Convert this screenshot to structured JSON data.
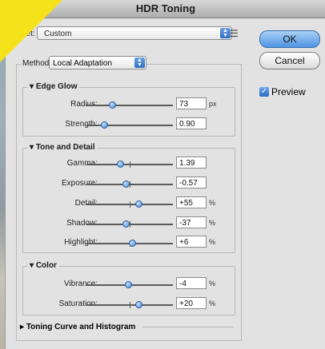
{
  "window": {
    "title": "HDR Toning"
  },
  "preset": {
    "label": "eset:",
    "value": "Custom"
  },
  "buttons": {
    "ok": "OK",
    "cancel": "Cancel"
  },
  "preview": {
    "label": "Preview",
    "checked": true
  },
  "method": {
    "label": "Method:",
    "value": "Local Adaptation"
  },
  "edge_glow": {
    "title": "Edge Glow",
    "radius": {
      "label": "Radius:",
      "value": "73",
      "unit": "px",
      "level": 0.3
    },
    "strength": {
      "label": "Strength:",
      "value": "0.90",
      "unit": "",
      "level": 0.2
    }
  },
  "tone_detail": {
    "title": "Tone and Detail",
    "gamma": {
      "label": "Gamma:",
      "value": "1.39",
      "unit": "",
      "level": 0.39
    },
    "exposure": {
      "label": "Exposure:",
      "value": "-0.57",
      "unit": "",
      "level": 0.45
    },
    "detail": {
      "label": "Detail:",
      "value": "+55",
      "unit": "%",
      "level": 0.6
    },
    "shadow": {
      "label": "Shadow:",
      "value": "-37",
      "unit": "%",
      "level": 0.45
    },
    "highlight": {
      "label": "Highlight:",
      "value": "+6",
      "unit": "%",
      "level": 0.53
    }
  },
  "color": {
    "title": "Color",
    "vibrance": {
      "label": "Vibrance:",
      "value": "-4",
      "unit": "%",
      "level": 0.48
    },
    "saturation": {
      "label": "Saturation:",
      "value": "+20",
      "unit": "%",
      "level": 0.6
    }
  },
  "toning_curve": {
    "title": "Toning Curve and Histogram"
  }
}
